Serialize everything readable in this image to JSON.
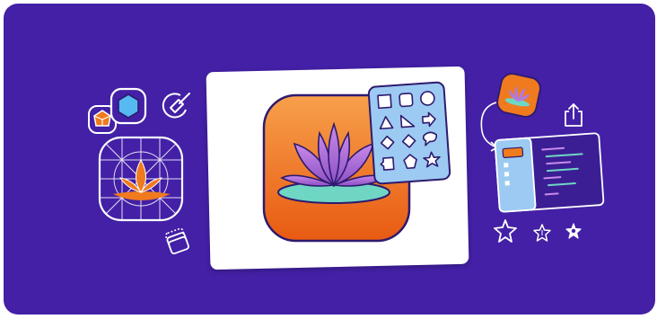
{
  "illustration": {
    "colors": {
      "background": "#4320A6",
      "accent_orange": "#F07A1E",
      "accent_purple": "#A86BD8",
      "accent_teal": "#6FD6C4",
      "accent_blue": "#9CCAF2",
      "stroke": "#2E1A6E"
    },
    "icons": [
      "gem-icon",
      "hexagon-icon",
      "pen-tool-icon",
      "grid-guide-icon",
      "layers-icon",
      "lotus-app-icon",
      "shape-library-icon",
      "app-icon-preview",
      "share-icon",
      "code-editor-icon",
      "sparkle-star-icon"
    ]
  }
}
